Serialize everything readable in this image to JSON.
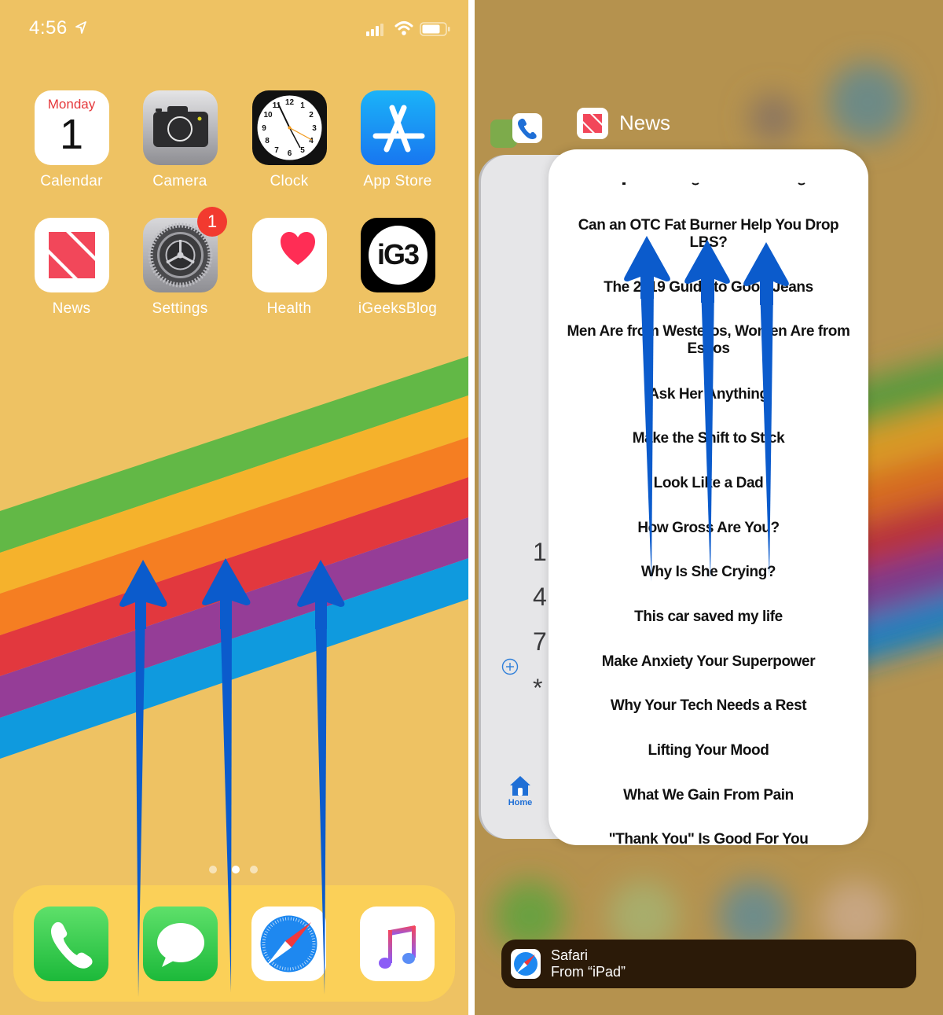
{
  "colors": {
    "wallpaper": "#eec263",
    "stripe_green": "#62b846",
    "stripe_yellow": "#f5b22c",
    "stripe_orange": "#f57e22",
    "stripe_red": "#e2383e",
    "stripe_purple": "#953d97",
    "stripe_blue": "#0f9ade",
    "arrow": "#0b5bcc",
    "badge": "#f23a2f"
  },
  "home_screen": {
    "status_bar": {
      "time": "4:56",
      "location_icon": "location-arrow-icon",
      "signal_icon": "cellular-signal-icon",
      "wifi_icon": "wifi-icon",
      "battery_icon": "battery-icon"
    },
    "apps": [
      {
        "label": "Calendar",
        "icon": "calendar-icon",
        "day": "Monday",
        "date": "1"
      },
      {
        "label": "Camera",
        "icon": "camera-icon"
      },
      {
        "label": "Clock",
        "icon": "clock-icon"
      },
      {
        "label": "App Store",
        "icon": "app-store-icon"
      },
      {
        "label": "News",
        "icon": "news-icon"
      },
      {
        "label": "Settings",
        "icon": "settings-gear-icon",
        "badge": "1"
      },
      {
        "label": "Health",
        "icon": "health-heart-icon"
      },
      {
        "label": "iGeeksBlog",
        "icon": "igeeksblog-icon",
        "logo_text": "iG3"
      }
    ],
    "page_dots": {
      "count": 3,
      "current": 2
    },
    "dock": [
      {
        "name": "Phone",
        "icon": "phone-icon"
      },
      {
        "name": "Messages",
        "icon": "messages-icon"
      },
      {
        "name": "Safari",
        "icon": "safari-compass-icon"
      },
      {
        "name": "Music",
        "icon": "music-note-icon"
      }
    ]
  },
  "app_switcher": {
    "current_app": {
      "label": "News",
      "icon": "news-icon"
    },
    "background_apps": [
      "Phone",
      "WhatsApp"
    ],
    "phone_card": {
      "add_icon": "add-circle-icon",
      "keys": [
        "1",
        "4",
        "7",
        "*"
      ],
      "tab_label": "Home",
      "tab_icon": "home-icon"
    },
    "news_headlines": [
      "Can an OTC Fat Burner Help You Drop LBS?",
      "The 2019 Guide to Good Jeans",
      "Men Are from Westeros, Women Are from Essos",
      "Ask Her Anything",
      "Make the Shift to Stick",
      "Look Like a Dad",
      "How Gross Are You?",
      "Why Is She Crying?",
      "This car saved my life",
      "Make Anxiety Your Superpower",
      "Why Your Tech Needs a Rest",
      "Lifting Your Mood",
      "What We Gain From Pain",
      "\"Thank You\" Is Good For You"
    ],
    "handoff": {
      "app": "Safari",
      "source": "From “iPad”",
      "icon": "safari-compass-icon"
    }
  },
  "annotations": {
    "gesture": "swipe-up",
    "arrow_count_per_panel": 3
  }
}
